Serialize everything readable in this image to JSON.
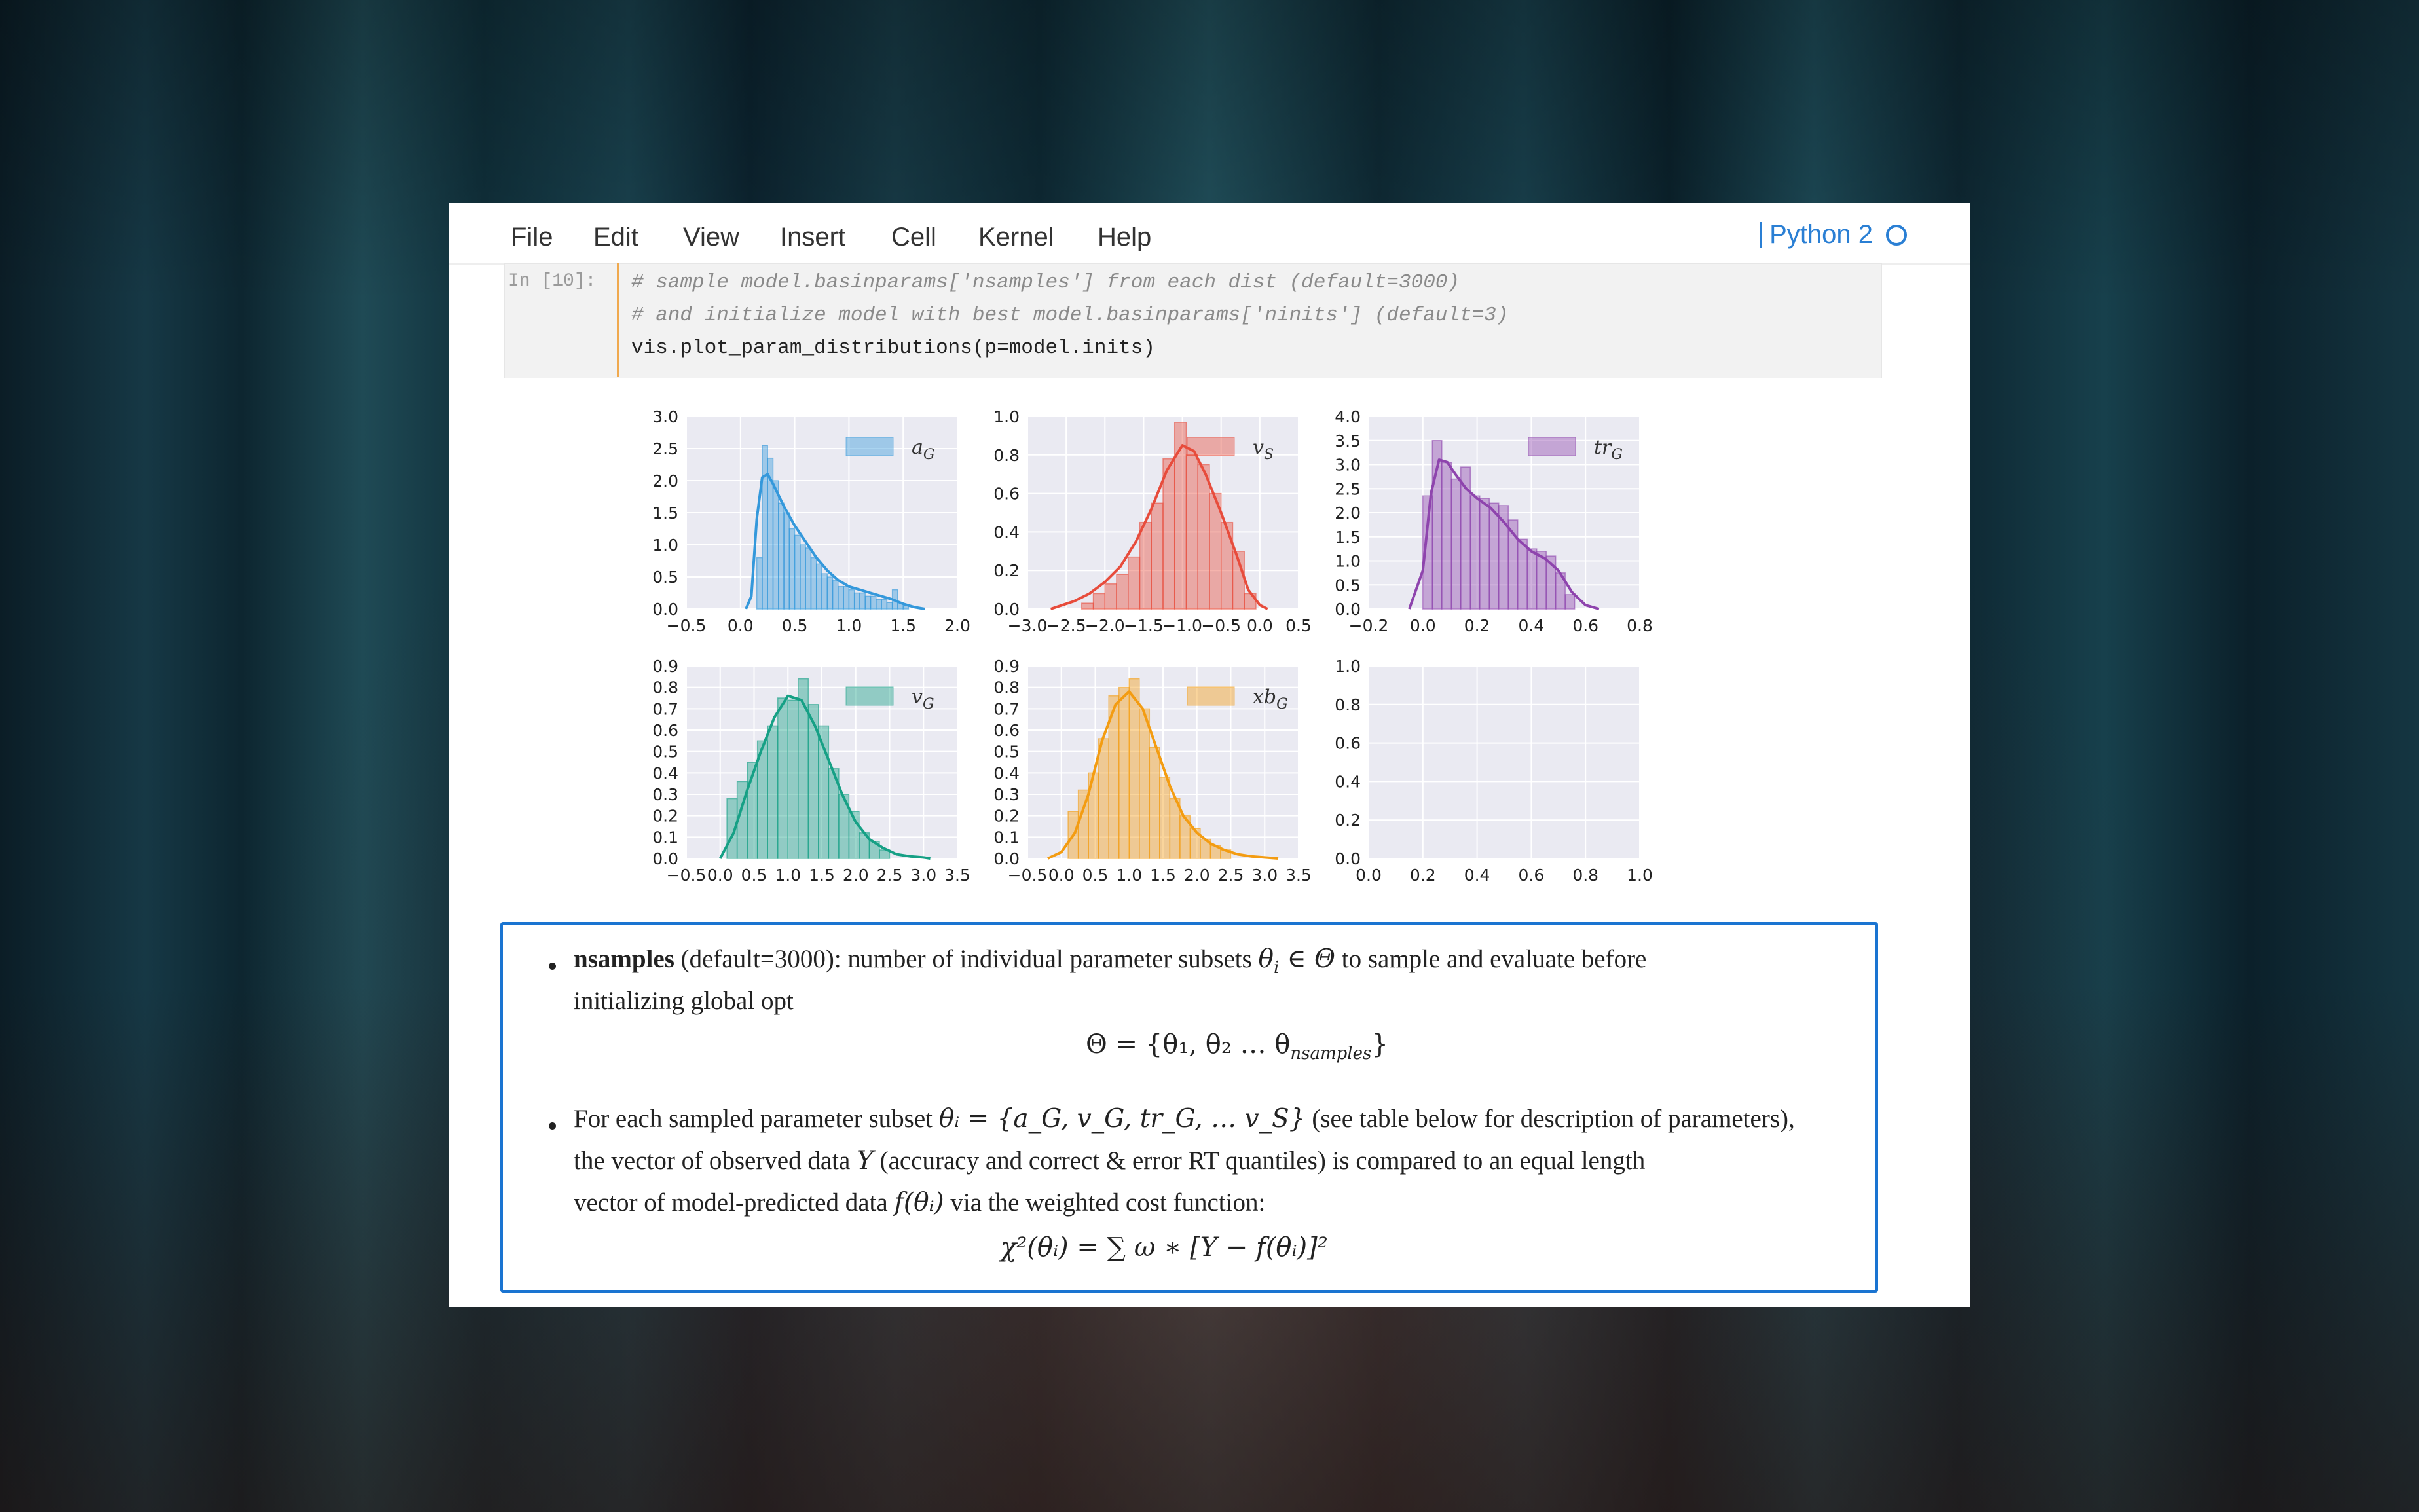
{
  "menu": {
    "file": "File",
    "edit": "Edit",
    "view": "View",
    "insert": "Insert",
    "cell": "Cell",
    "kernel": "Kernel",
    "help": "Help"
  },
  "kernel_indicator": {
    "name": "Python 2"
  },
  "input_cell": {
    "prompt": "In [10]:",
    "line1": "# sample model.basinparams['nsamples'] from each dist (default=3000)",
    "line2": "# and initialize model with best model.basinparams['ninits'] (default=3)",
    "line3": "vis.plot_param_distributions(p=model.inits)"
  },
  "colors": {
    "a_G": "#3498db",
    "v_S": "#e74c3c",
    "tr_G": "#8e44ad",
    "v_G": "#16a085",
    "xb_G": "#f39c12",
    "plot_bg": "#eaeaf2",
    "accent": "#1a74d1"
  },
  "chart_data": [
    {
      "type": "histogram+kde",
      "legend": "a_G",
      "legend_text": "a",
      "legend_sub": "G",
      "xlim": [
        -0.5,
        2.0
      ],
      "ylim": [
        0.0,
        3.0
      ],
      "xticks": [
        "−0.5",
        "0.0",
        "0.5",
        "1.0",
        "1.5",
        "2.0"
      ],
      "yticks": [
        "0.0",
        "0.5",
        "1.0",
        "1.5",
        "2.0",
        "2.5",
        "3.0"
      ],
      "bins_x": [
        0.15,
        0.2,
        0.25,
        0.3,
        0.35,
        0.4,
        0.45,
        0.5,
        0.55,
        0.6,
        0.65,
        0.7,
        0.75,
        0.8,
        0.85,
        0.9,
        0.95,
        1.0,
        1.05,
        1.1,
        1.15,
        1.2,
        1.25,
        1.3,
        1.35,
        1.4,
        1.45,
        1.5
      ],
      "bin_width": 0.05,
      "heights": [
        0.8,
        2.55,
        2.35,
        2.0,
        1.65,
        1.5,
        1.25,
        1.15,
        1.0,
        0.95,
        0.8,
        0.7,
        0.55,
        0.5,
        0.45,
        0.35,
        0.35,
        0.3,
        0.25,
        0.25,
        0.2,
        0.2,
        0.15,
        0.15,
        0.1,
        0.3,
        0.1,
        0.05
      ],
      "kde_x": [
        0.05,
        0.1,
        0.15,
        0.2,
        0.25,
        0.3,
        0.4,
        0.5,
        0.6,
        0.7,
        0.8,
        0.9,
        1.0,
        1.1,
        1.2,
        1.3,
        1.4,
        1.5,
        1.6,
        1.7
      ],
      "kde_y": [
        0.0,
        0.2,
        1.4,
        2.05,
        2.1,
        1.95,
        1.6,
        1.3,
        1.05,
        0.8,
        0.6,
        0.45,
        0.35,
        0.3,
        0.25,
        0.2,
        0.15,
        0.08,
        0.03,
        0.0
      ]
    },
    {
      "type": "histogram+kde",
      "legend": "v_S",
      "legend_text": "v",
      "legend_sub": "S",
      "xlim": [
        -3.0,
        0.5
      ],
      "ylim": [
        0.0,
        1.0
      ],
      "xticks": [
        "−3.0",
        "−2.5",
        "−2.0",
        "−1.5",
        "−1.0",
        "−0.5",
        "0.0",
        "0.5"
      ],
      "yticks": [
        "0.0",
        "0.2",
        "0.4",
        "0.6",
        "0.8",
        "1.0"
      ],
      "bins_x": [
        -2.3,
        -2.15,
        -2.0,
        -1.85,
        -1.7,
        -1.55,
        -1.4,
        -1.25,
        -1.1,
        -0.95,
        -0.8,
        -0.65,
        -0.5,
        -0.35,
        -0.2
      ],
      "bin_width": 0.15,
      "heights": [
        0.03,
        0.08,
        0.13,
        0.18,
        0.27,
        0.45,
        0.55,
        0.78,
        0.97,
        0.8,
        0.75,
        0.6,
        0.45,
        0.3,
        0.08
      ],
      "kde_x": [
        -2.7,
        -2.4,
        -2.2,
        -2.0,
        -1.8,
        -1.6,
        -1.4,
        -1.2,
        -1.0,
        -0.85,
        -0.7,
        -0.5,
        -0.3,
        -0.15,
        0.0,
        0.1
      ],
      "kde_y": [
        0.0,
        0.04,
        0.08,
        0.14,
        0.22,
        0.35,
        0.52,
        0.72,
        0.85,
        0.82,
        0.7,
        0.5,
        0.28,
        0.1,
        0.02,
        0.0
      ]
    },
    {
      "type": "histogram+kde",
      "legend": "tr_G",
      "legend_text": "tr",
      "legend_sub": "G",
      "xlim": [
        -0.2,
        0.8
      ],
      "ylim": [
        0.0,
        4.0
      ],
      "xticks": [
        "−0.2",
        "0.0",
        "0.2",
        "0.4",
        "0.6",
        "0.8"
      ],
      "yticks": [
        "0.0",
        "0.5",
        "1.0",
        "1.5",
        "2.0",
        "2.5",
        "3.0",
        "3.5",
        "4.0"
      ],
      "bins_x": [
        0.0,
        0.035,
        0.07,
        0.105,
        0.14,
        0.175,
        0.21,
        0.245,
        0.28,
        0.315,
        0.35,
        0.385,
        0.42,
        0.455,
        0.49,
        0.525
      ],
      "bin_width": 0.035,
      "heights": [
        2.35,
        3.5,
        3.05,
        2.7,
        2.95,
        2.35,
        2.3,
        2.2,
        2.15,
        1.85,
        1.45,
        1.25,
        1.2,
        1.1,
        0.75,
        0.3
      ],
      "kde_x": [
        -0.05,
        0.0,
        0.03,
        0.06,
        0.09,
        0.12,
        0.16,
        0.2,
        0.25,
        0.3,
        0.35,
        0.4,
        0.45,
        0.5,
        0.55,
        0.6,
        0.65
      ],
      "kde_y": [
        0.0,
        0.8,
        2.4,
        3.1,
        3.05,
        2.8,
        2.5,
        2.3,
        2.1,
        1.8,
        1.45,
        1.2,
        1.05,
        0.8,
        0.35,
        0.08,
        0.0
      ]
    },
    {
      "type": "histogram+kde",
      "legend": "v_G",
      "legend_text": "v",
      "legend_sub": "G",
      "xlim": [
        -0.5,
        3.5
      ],
      "ylim": [
        0.0,
        0.9
      ],
      "xticks": [
        "−0.5",
        "0.0",
        "0.5",
        "1.0",
        "1.5",
        "2.0",
        "2.5",
        "3.0",
        "3.5"
      ],
      "yticks": [
        "0.0",
        "0.1",
        "0.2",
        "0.3",
        "0.4",
        "0.5",
        "0.6",
        "0.7",
        "0.8",
        "0.9"
      ],
      "bins_x": [
        0.1,
        0.25,
        0.4,
        0.55,
        0.7,
        0.85,
        1.0,
        1.15,
        1.3,
        1.45,
        1.6,
        1.75,
        1.9,
        2.05,
        2.2,
        2.35
      ],
      "bin_width": 0.15,
      "heights": [
        0.28,
        0.36,
        0.45,
        0.55,
        0.62,
        0.75,
        0.74,
        0.84,
        0.72,
        0.62,
        0.42,
        0.3,
        0.22,
        0.12,
        0.08,
        0.04
      ],
      "kde_x": [
        0.0,
        0.2,
        0.4,
        0.6,
        0.8,
        1.0,
        1.2,
        1.4,
        1.6,
        1.8,
        2.0,
        2.2,
        2.4,
        2.6,
        2.8,
        3.0,
        3.1
      ],
      "kde_y": [
        0.0,
        0.12,
        0.32,
        0.5,
        0.66,
        0.76,
        0.74,
        0.62,
        0.46,
        0.3,
        0.17,
        0.09,
        0.05,
        0.02,
        0.01,
        0.005,
        0.0
      ]
    },
    {
      "type": "histogram+kde",
      "legend": "xb_G",
      "legend_text": "xb",
      "legend_sub": "G",
      "xlim": [
        -0.5,
        3.5
      ],
      "ylim": [
        0.0,
        0.9
      ],
      "xticks": [
        "−0.5",
        "0.0",
        "0.5",
        "1.0",
        "1.5",
        "2.0",
        "2.5",
        "3.0",
        "3.5"
      ],
      "yticks": [
        "0.0",
        "0.1",
        "0.2",
        "0.3",
        "0.4",
        "0.5",
        "0.6",
        "0.7",
        "0.8",
        "0.9"
      ],
      "bins_x": [
        0.1,
        0.25,
        0.4,
        0.55,
        0.7,
        0.85,
        1.0,
        1.15,
        1.3,
        1.45,
        1.6,
        1.75,
        1.9,
        2.05,
        2.2,
        2.35
      ],
      "bin_width": 0.15,
      "heights": [
        0.22,
        0.32,
        0.4,
        0.56,
        0.76,
        0.8,
        0.84,
        0.7,
        0.52,
        0.38,
        0.28,
        0.2,
        0.14,
        0.09,
        0.06,
        0.04
      ],
      "kde_x": [
        -0.2,
        0.0,
        0.2,
        0.4,
        0.6,
        0.8,
        1.0,
        1.2,
        1.4,
        1.6,
        1.8,
        2.0,
        2.2,
        2.4,
        2.6,
        2.8,
        3.0,
        3.2
      ],
      "kde_y": [
        0.0,
        0.03,
        0.12,
        0.3,
        0.55,
        0.72,
        0.78,
        0.7,
        0.52,
        0.34,
        0.2,
        0.12,
        0.07,
        0.04,
        0.02,
        0.01,
        0.005,
        0.0
      ]
    },
    {
      "type": "empty",
      "xlim": [
        0.0,
        1.0
      ],
      "ylim": [
        0.0,
        1.0
      ],
      "xticks": [
        "0.0",
        "0.2",
        "0.4",
        "0.6",
        "0.8",
        "1.0"
      ],
      "yticks": [
        "0.0",
        "0.2",
        "0.4",
        "0.6",
        "0.8",
        "1.0"
      ]
    }
  ],
  "markdown": {
    "b1_bold": "nsamples",
    "b1_text": " (default=3000): number of individual parameter subsets ",
    "b1_math1": "θ",
    "b1_math1_sub": "i",
    "b1_math2": " ∈ Θ",
    "b1_text2": " to sample and evaluate before",
    "b1_line2": "initializing global opt",
    "eq1": "Θ = {θ₁, θ₂ … θ",
    "eq1_sub": "nsamples",
    "eq1_end": "}",
    "b2_text1": "For each sampled parameter subset ",
    "b2_math": "θᵢ = {a_G, v_G, tr_G, … v_S}",
    "b2_text2": " (see table below for description of parameters),",
    "b2_line2a": "the vector of observed data ",
    "b2_line2_math": "Y",
    "b2_line2b": " (accuracy and correct & error RT quantiles) is compared to an equal length",
    "b2_line3a": "vector of model-predicted data ",
    "b2_line3_math": "f(θᵢ)",
    "b2_line3b": " via the weighted cost function:",
    "eq2": "χ²(θᵢ) = ∑ ω ∗ [Y − f(θᵢ)]²"
  }
}
